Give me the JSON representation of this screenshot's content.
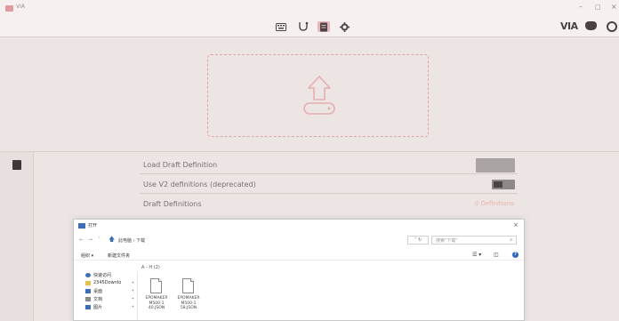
{
  "window": {
    "title": "VIA",
    "minimize": "–",
    "maximize": "□",
    "close": "×"
  },
  "toolbar": {
    "icons": [
      "keyboard-icon",
      "key-test-icon",
      "design-icon",
      "settings-icon"
    ],
    "active_icon": "design-icon",
    "logo_text": "VIA",
    "right_icons": [
      "discord-icon",
      "github-icon"
    ]
  },
  "upload": {
    "icon": "upload-icon",
    "accent_color": "#e0a6a6"
  },
  "sidebar": {
    "icons": [
      "document-icon"
    ]
  },
  "settings": {
    "rows": [
      {
        "label": "Load Draft Definition",
        "control": "button"
      },
      {
        "label": "Use V2 definitions (deprecated)",
        "control": "toggle",
        "value": "on"
      },
      {
        "label": "Draft Definitions",
        "control": "text",
        "value": "0 Definitions"
      }
    ]
  },
  "file_dialog": {
    "title": "打开",
    "close": "×",
    "breadcrumb": "此电脑 › 下载",
    "search_placeholder": "搜索\"下载\"",
    "commands": {
      "organize": "组织 ▾",
      "new_folder": "新建文件夹"
    },
    "nav_items": [
      {
        "label": "快速访问",
        "icon": "star-icon",
        "color": "#3d6fb8"
      },
      {
        "label": "2345Downlo",
        "icon": "folder-icon",
        "color": "#e8c050"
      },
      {
        "label": "桌面",
        "icon": "desktop-icon",
        "color": "#3d6fb8"
      },
      {
        "label": "文档",
        "icon": "documents-icon",
        "color": "#8a8a8a"
      },
      {
        "label": "图片",
        "icon": "pictures-icon",
        "color": "#3d6fb8"
      }
    ],
    "group_header": "A - H (2)",
    "files": [
      {
        "name": "EPOMAKER M500-1 40.JSON"
      },
      {
        "name": "EPOMAKER M500-1 58.JSON"
      }
    ]
  }
}
